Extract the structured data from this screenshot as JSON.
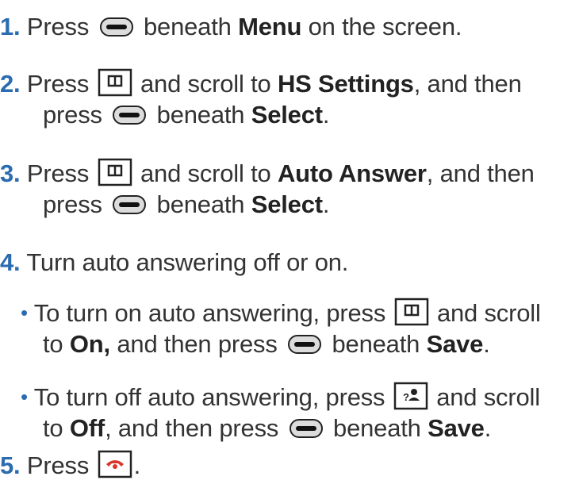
{
  "steps": [
    {
      "number": "1.",
      "lines": [
        {
          "t1": "Press",
          "t2": "beneath",
          "b1": "Menu",
          "t3": "on the screen."
        }
      ]
    },
    {
      "number": "2.",
      "lines": [
        {
          "t1": "Press",
          "t2": "and scroll to",
          "b1": "HS Settings",
          "t3": ", and then"
        },
        {
          "t1": "press",
          "t2": "beneath",
          "b1": "Select",
          "t3": "."
        }
      ]
    },
    {
      "number": "3.",
      "lines": [
        {
          "t1": "Press",
          "t2": "and scroll to",
          "b1": "Auto Answer",
          "t3": ", and then"
        },
        {
          "t1": "press",
          "t2": "beneath",
          "b1": "Select",
          "t3": "."
        }
      ]
    },
    {
      "number": "4.",
      "text": "Turn auto answering off or on."
    },
    {
      "bullets": [
        {
          "l1": "To turn on auto answering, press",
          "l1b": "and scroll",
          "l2a": "to",
          "l2bold": "On,",
          "l2b": "and then press",
          "l2c": "beneath",
          "l2save": "Save",
          "l2end": "."
        },
        {
          "l1": "To turn off auto answering, press",
          "l1b": "and scroll",
          "l2a": "to",
          "l2bold": "Off",
          "l2b": ", and then press",
          "l2c": "beneath",
          "l2save": "Save",
          "l2end": "."
        }
      ]
    },
    {
      "number": "5.",
      "t1": "Press",
      "t2": "."
    }
  ],
  "icons": {
    "soft": "soft-key-icon",
    "nav": "navigation-book-key-icon",
    "contacts": "contacts-key-icon",
    "end": "end-call-key-icon",
    "accent": "#2b6cb0"
  }
}
